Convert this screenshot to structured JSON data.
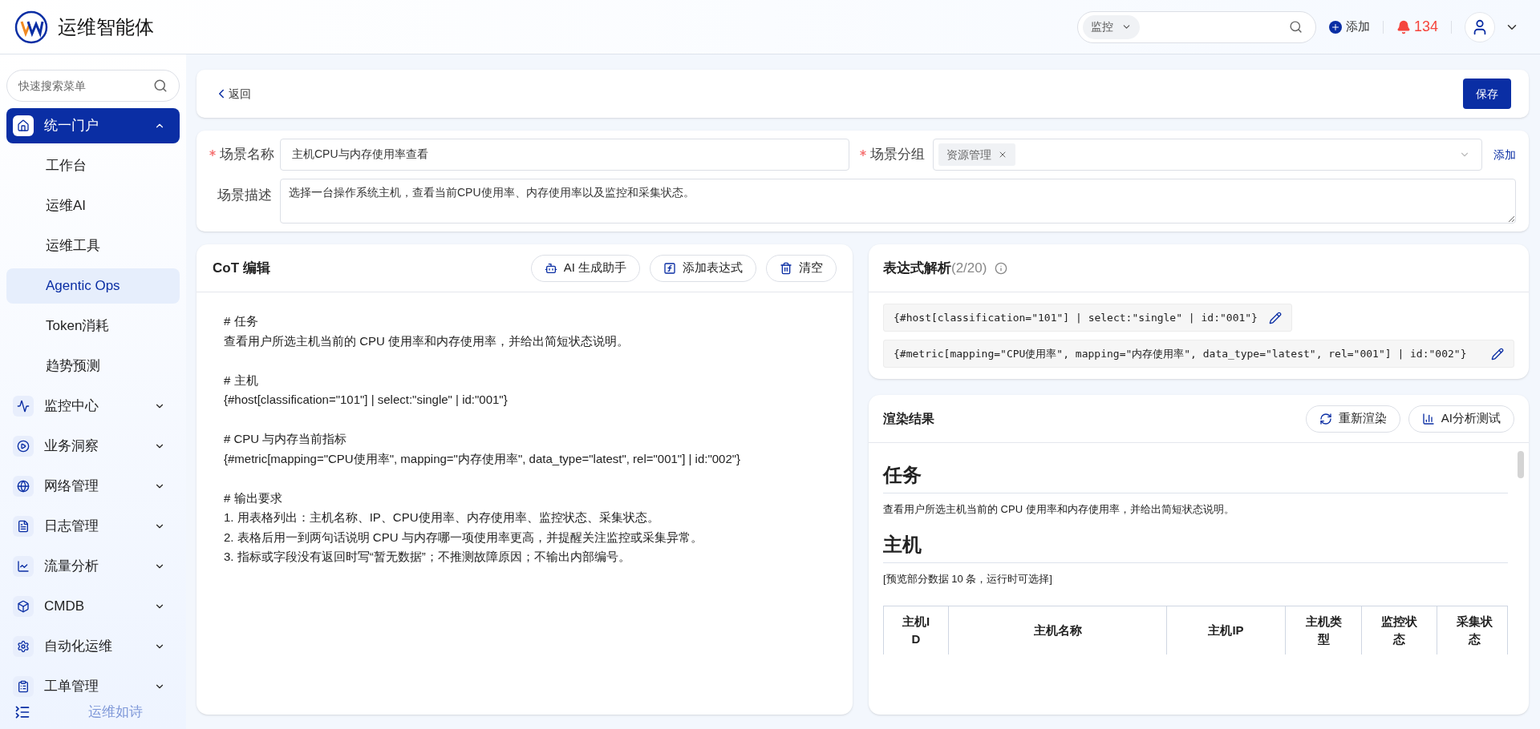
{
  "header": {
    "app_title": "运维智能体",
    "search": {
      "scope": "监控"
    },
    "add_label": "添加",
    "alert_count": "134"
  },
  "sidebar": {
    "search_placeholder": "快速搜索菜单",
    "items": [
      {
        "label": "统一门户",
        "expanded": true,
        "selected": true,
        "children": [
          {
            "label": "工作台",
            "selected": false
          },
          {
            "label": "运维AI",
            "selected": false
          },
          {
            "label": "运维工具",
            "selected": false
          },
          {
            "label": "Agentic Ops",
            "selected": true
          },
          {
            "label": "Token消耗",
            "selected": false
          },
          {
            "label": "趋势预测",
            "selected": false
          }
        ]
      },
      {
        "label": "监控中心",
        "expanded": false,
        "selected": false
      },
      {
        "label": "业务洞察",
        "expanded": false,
        "selected": false
      },
      {
        "label": "网络管理",
        "expanded": false,
        "selected": false
      },
      {
        "label": "日志管理",
        "expanded": false,
        "selected": false
      },
      {
        "label": "流量分析",
        "expanded": false,
        "selected": false
      },
      {
        "label": "CMDB",
        "expanded": false,
        "selected": false
      },
      {
        "label": "自动化运维",
        "expanded": false,
        "selected": false
      },
      {
        "label": "工单管理",
        "expanded": false,
        "selected": false
      }
    ],
    "footer": "运维如诗"
  },
  "toolbar": {
    "back": "返回",
    "save": "保存"
  },
  "form": {
    "name": {
      "label": "场景名称",
      "required": true,
      "value": "主机CPU与内存使用率查看"
    },
    "group": {
      "label": "场景分组",
      "required": true,
      "tags": [
        "资源管理"
      ],
      "add": "添加"
    },
    "description": {
      "label": "场景描述",
      "required": false,
      "value": "选择一台操作系统主机，查看当前CPU使用率、内存使用率以及监控和采集状态。"
    }
  },
  "cot": {
    "title": "CoT 编辑",
    "buttons": [
      "AI 生成助手",
      "添加表达式",
      "清空"
    ],
    "sections": [
      [
        "# 任务",
        "查看用户所选主机当前的 CPU 使用率和内存使用率，并给出简短状态说明。"
      ],
      [
        "# 主机",
        "{#host[classification=\"101\"] | select:\"single\" | id:\"001\"}"
      ],
      [
        "# CPU 与内存当前指标",
        "{#metric[mapping=\"CPU使用率\", mapping=\"内存使用率\", data_type=\"latest\", rel=\"001\"] | id:\"002\"}"
      ],
      [
        "# 输出要求",
        "1. 用表格列出：主机名称、IP、CPU使用率、内存使用率、监控状态、采集状态。",
        "2. 表格后用一到两句话说明 CPU 与内存哪一项使用率更高，并提醒关注监控或采集异常。",
        "3. 指标或字段没有返回时写“暂无数据”；不推测故障原因；不输出内部编号。"
      ]
    ]
  },
  "expressions": {
    "title": "表达式解析",
    "count": "(2/20)",
    "items": [
      "{#host[classification=\"101\"] | select:\"single\" | id:\"001\"}",
      "{#metric[mapping=\"CPU使用率\", mapping=\"内存使用率\", data_type=\"latest\", rel=\"001\"] | id:\"002\"}"
    ]
  },
  "render": {
    "title": "渲染结果",
    "buttons": [
      "重新渲染",
      "AI分析测试"
    ],
    "blocks": [
      {
        "kind": "heading",
        "text": "任务"
      },
      {
        "kind": "paragraph",
        "text": "查看用户所选主机当前的 CPU 使用率和内存使用率，并给出简短状态说明。"
      },
      {
        "kind": "heading",
        "text": "主机"
      },
      {
        "kind": "paragraph",
        "text": "[预览部分数据 10 条，运行时可选择]"
      },
      {
        "kind": "table",
        "columns": [
          "主机ID",
          "主机名称",
          "主机IP",
          "主机类型",
          "监控状态",
          "采集状态"
        ]
      }
    ]
  }
}
